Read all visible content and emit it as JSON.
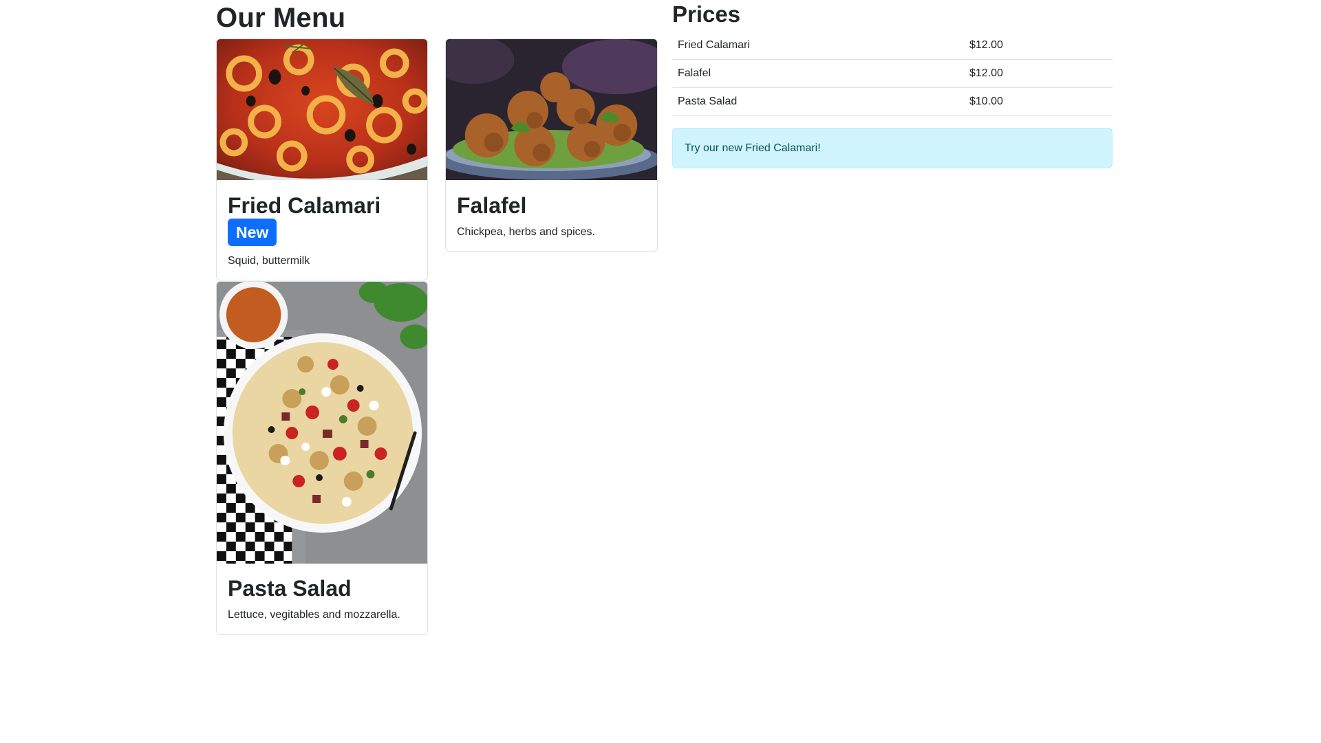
{
  "menu": {
    "title": "Our Menu",
    "items": [
      {
        "name": "Fried Calamari",
        "badge": "New",
        "description": "Squid, buttermilk",
        "image_icon": "fried-calamari-photo"
      },
      {
        "name": "Falafel",
        "description": "Chickpea, herbs and spices.",
        "image_icon": "falafel-photo"
      },
      {
        "name": "Pasta Salad",
        "description": "Lettuce, vegitables and mozzarella.",
        "image_icon": "pasta-salad-photo"
      }
    ]
  },
  "prices": {
    "title": "Prices",
    "rows": [
      {
        "name": "Fried Calamari",
        "price": "$12.00"
      },
      {
        "name": "Falafel",
        "price": "$12.00"
      },
      {
        "name": "Pasta Salad",
        "price": "$10.00"
      }
    ]
  },
  "alert": {
    "text": "Try our new Fried Calamari!"
  },
  "colors": {
    "badge_bg": "#0d6efd",
    "alert_bg": "#cff4fc",
    "alert_text": "#055160",
    "border": "#dee2e6"
  }
}
